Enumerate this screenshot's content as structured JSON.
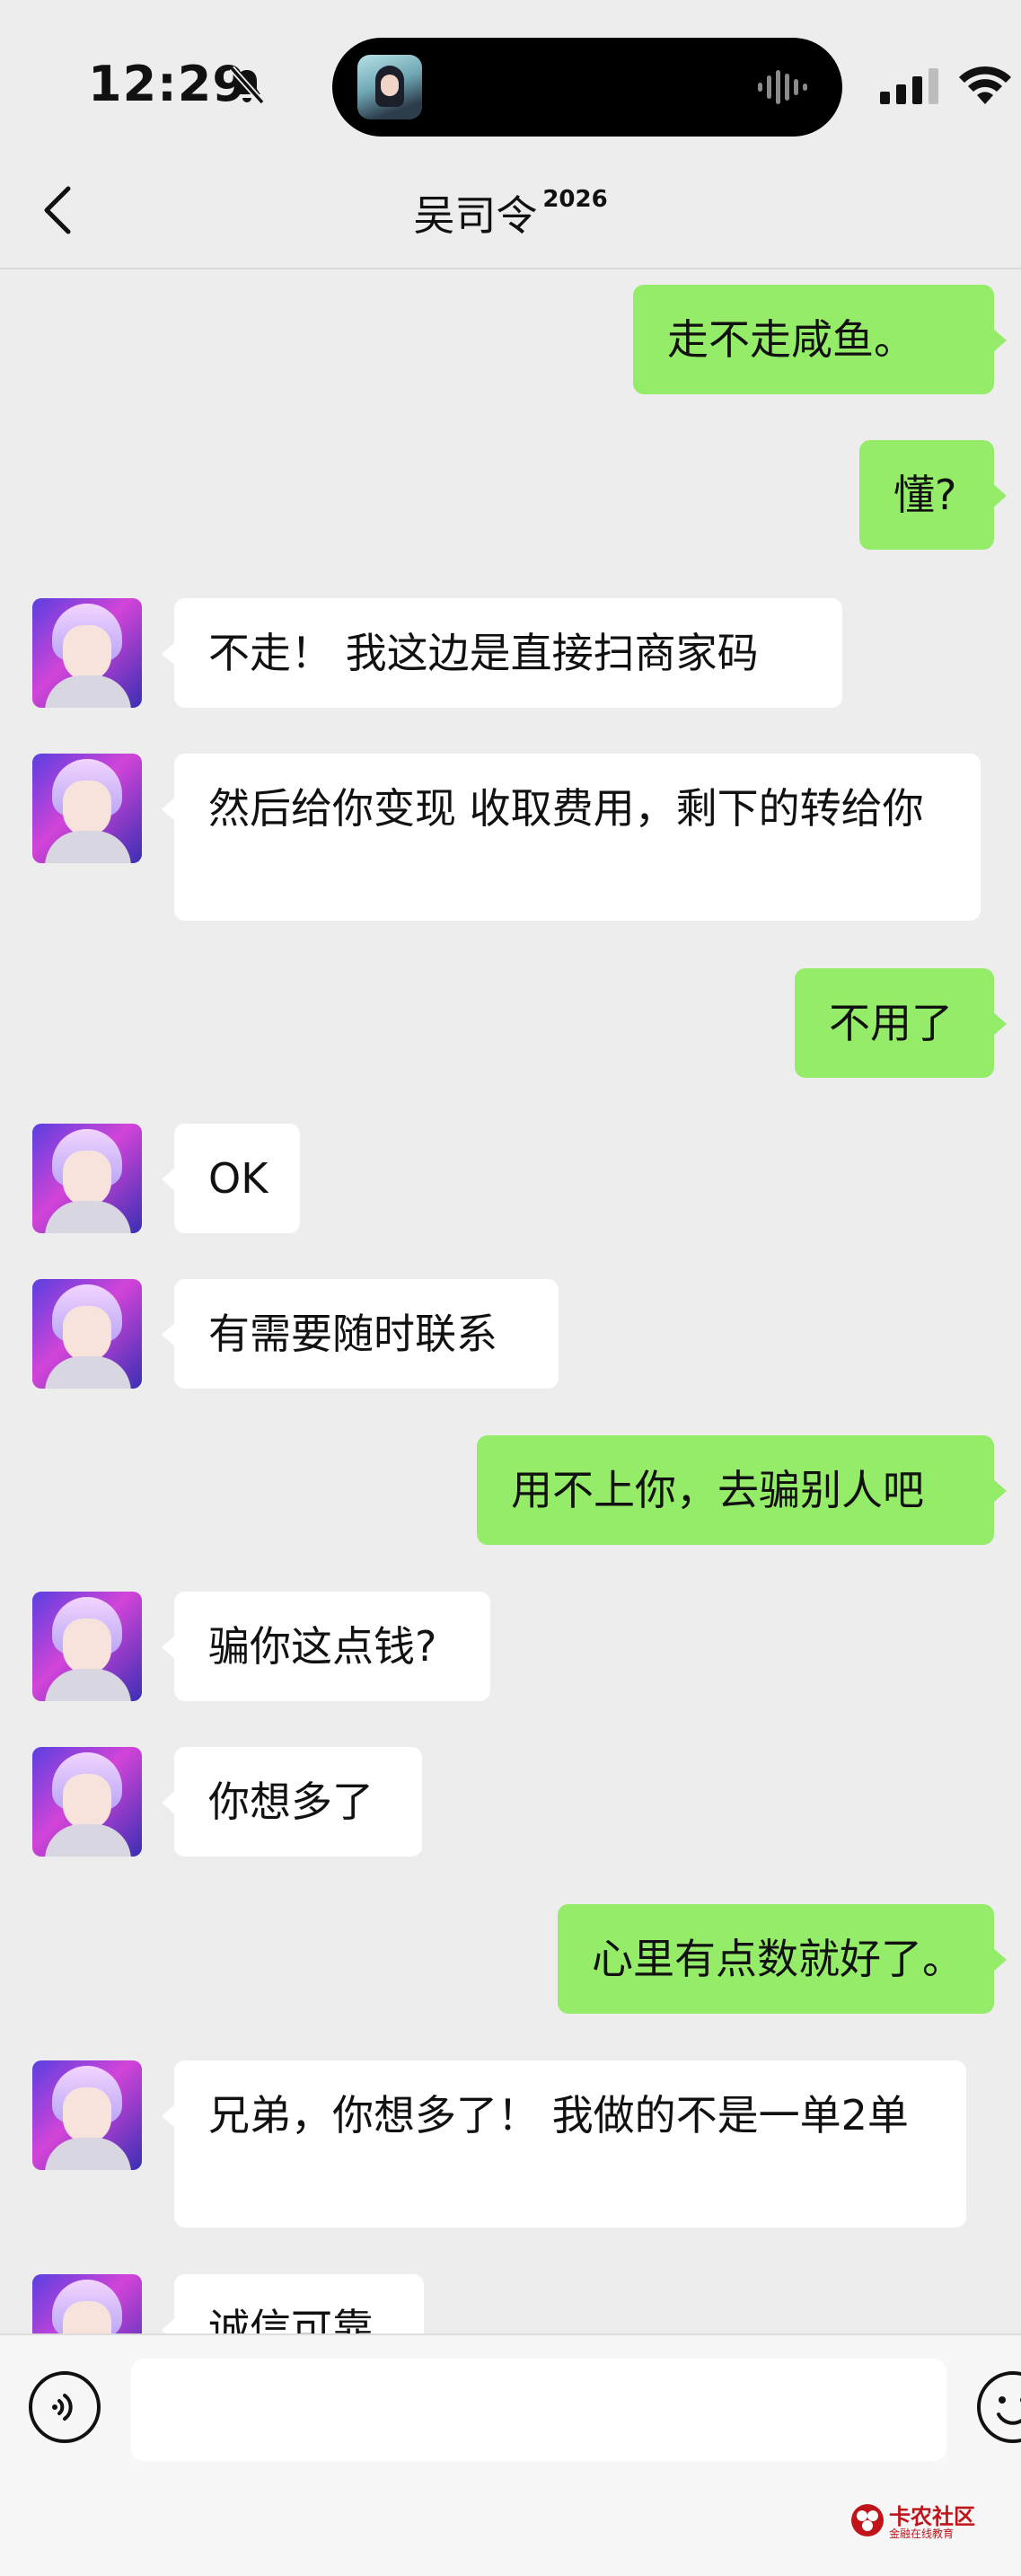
{
  "status_bar": {
    "time": "12:29"
  },
  "header": {
    "title": "吴司令",
    "title_suffix": "2026"
  },
  "messages": [
    {
      "side": "right",
      "text": "走不走咸鱼。"
    },
    {
      "side": "right",
      "text": "懂?"
    },
    {
      "side": "left",
      "text": "不走！ 我这边是直接扫商家码"
    },
    {
      "side": "left",
      "text": "然后给你变现 收取费用，剩下的转给你"
    },
    {
      "side": "right",
      "text": "不用了"
    },
    {
      "side": "left",
      "text": "OK"
    },
    {
      "side": "left",
      "text": "有需要随时联系"
    },
    {
      "side": "right",
      "text": "用不上你，去骗别人吧"
    },
    {
      "side": "left",
      "text": "骗你这点钱?"
    },
    {
      "side": "left",
      "text": "你想多了"
    },
    {
      "side": "right",
      "text": "心里有点数就好了。"
    },
    {
      "side": "left",
      "text": "兄弟，你想多了！ 我做的不是一单2单"
    },
    {
      "side": "left",
      "text": "诚信可靠"
    }
  ],
  "input": {
    "value": "",
    "placeholder": ""
  },
  "watermark": {
    "title": "卡农社区",
    "subtitle": "金融在线教育"
  },
  "colors": {
    "background": "#ededed",
    "outgoing_bubble": "#95ec69",
    "incoming_bubble": "#ffffff"
  }
}
